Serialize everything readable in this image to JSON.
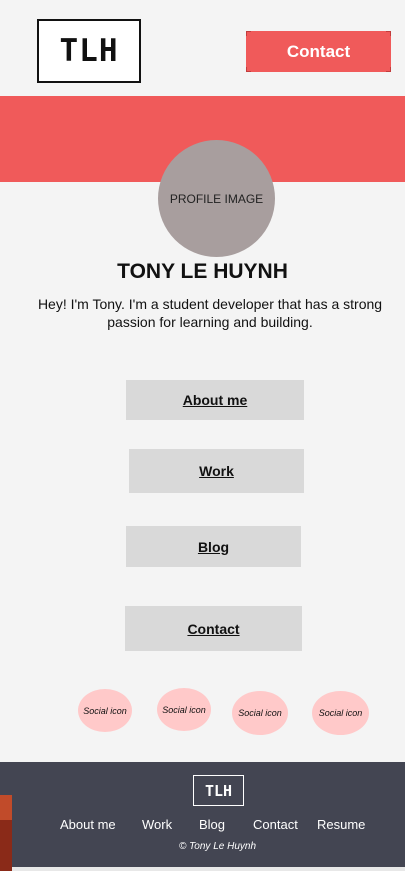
{
  "header": {
    "logo": "TLH",
    "contact_button": "Contact"
  },
  "profile": {
    "image_label": "PROFILE IMAGE",
    "name": "TONY LE HUYNH",
    "bio": "Hey! I'm Tony. I'm a student developer that has a strong passion for learning and building."
  },
  "nav": {
    "about": "About me",
    "work": "Work",
    "blog": "Blog",
    "contact": "Contact"
  },
  "social": [
    "Social icon",
    "Social icon",
    "Social icon",
    "Social icon"
  ],
  "footer": {
    "logo": "TLH",
    "links": [
      "About me",
      "Work",
      "Blog",
      "Contact",
      "Resume"
    ],
    "copyright": "© Tony Le Huynh"
  },
  "colors": {
    "accent": "#f05a5a",
    "footer_bg": "#434552",
    "nav_button_bg": "#d9d9d9",
    "social_bg": "#ffc9c9",
    "profile_bg": "#a89e9e"
  }
}
